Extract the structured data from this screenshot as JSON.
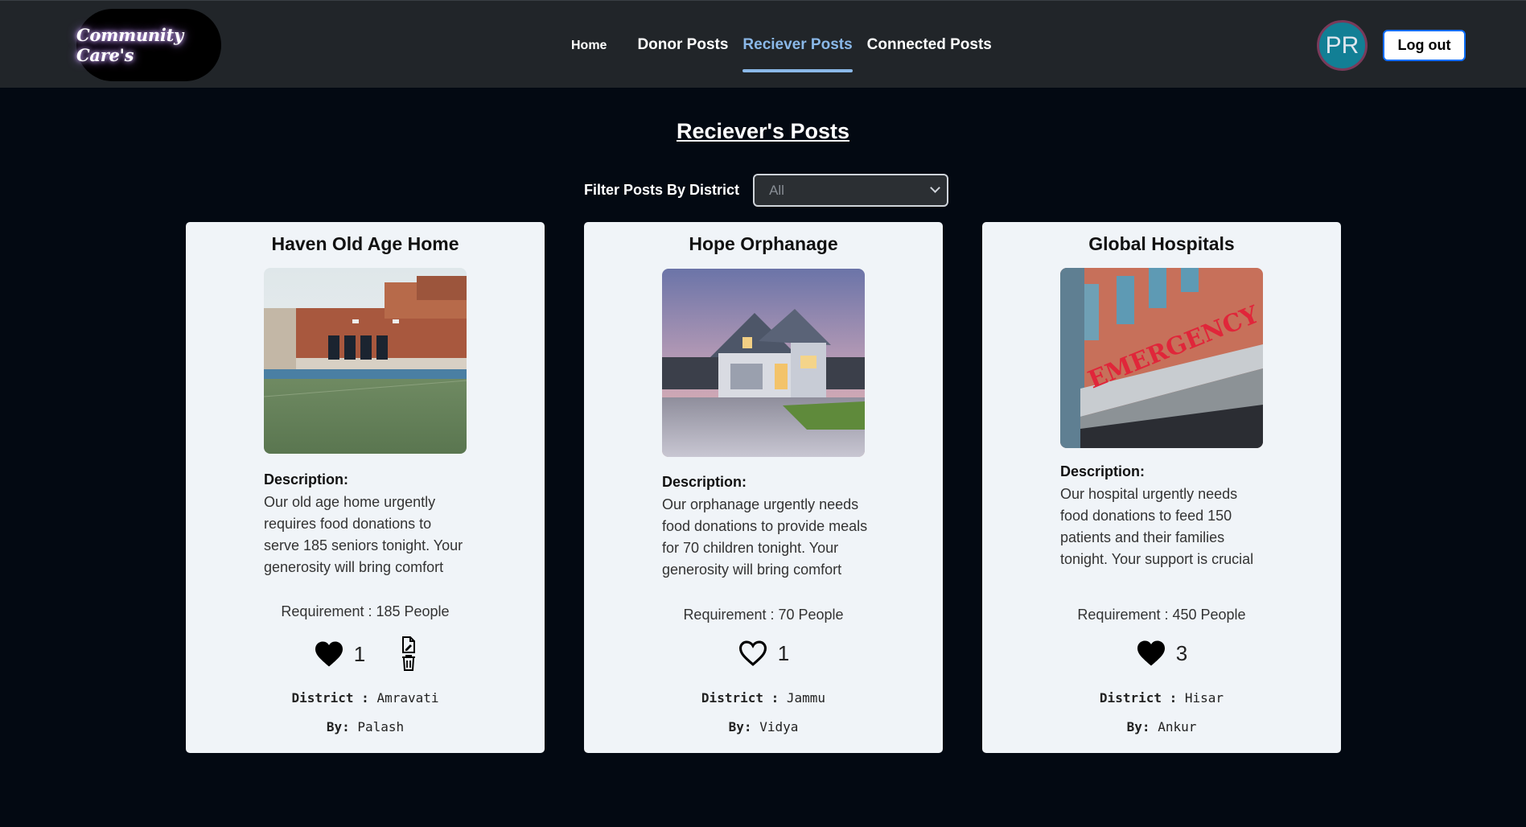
{
  "brand": {
    "logo_text": "Community Care's"
  },
  "nav": {
    "home": "Home",
    "donor_posts": "Donor Posts",
    "reciever_posts": "Reciever Posts",
    "connected_posts": "Connected Posts",
    "active": "Reciever Posts"
  },
  "user": {
    "initials": "PR",
    "logout_label": "Log out"
  },
  "page": {
    "title": "Reciever's Posts",
    "filter_label": "Filter Posts By District",
    "filter_value": "All"
  },
  "labels": {
    "description": "Description:",
    "district": "District :",
    "by": "By:"
  },
  "posts": [
    {
      "title": "Haven Old Age Home",
      "description": "Our old age home urgently requires food donations to serve 185 seniors tonight. Your generosity will bring comfort and support to them in their time of need.",
      "requirement": "Requirement : 185 People",
      "likes": "1",
      "liked": true,
      "owner_actions": true,
      "district": "Amravati",
      "by": "Palash",
      "image": "school-building"
    },
    {
      "title": "Hope Orphanage",
      "description": "Our orphanage urgently needs food donations to provide meals for 70 children tonight. Your generosity will bring comfort and nourishment to them.",
      "requirement": "Requirement : 70 People",
      "likes": "1",
      "liked": false,
      "owner_actions": false,
      "district": "Jammu",
      "by": "Vidya",
      "image": "house"
    },
    {
      "title": "Global Hospitals",
      "description": "Our hospital urgently needs food donations to feed 150 patients and their families tonight. Your support is crucial in helping us provide care and",
      "requirement": "Requirement : 450 People",
      "likes": "3",
      "liked": true,
      "owner_actions": false,
      "district": "Hisar",
      "by": "Ankur",
      "image": "hospital-emergency"
    }
  ]
}
